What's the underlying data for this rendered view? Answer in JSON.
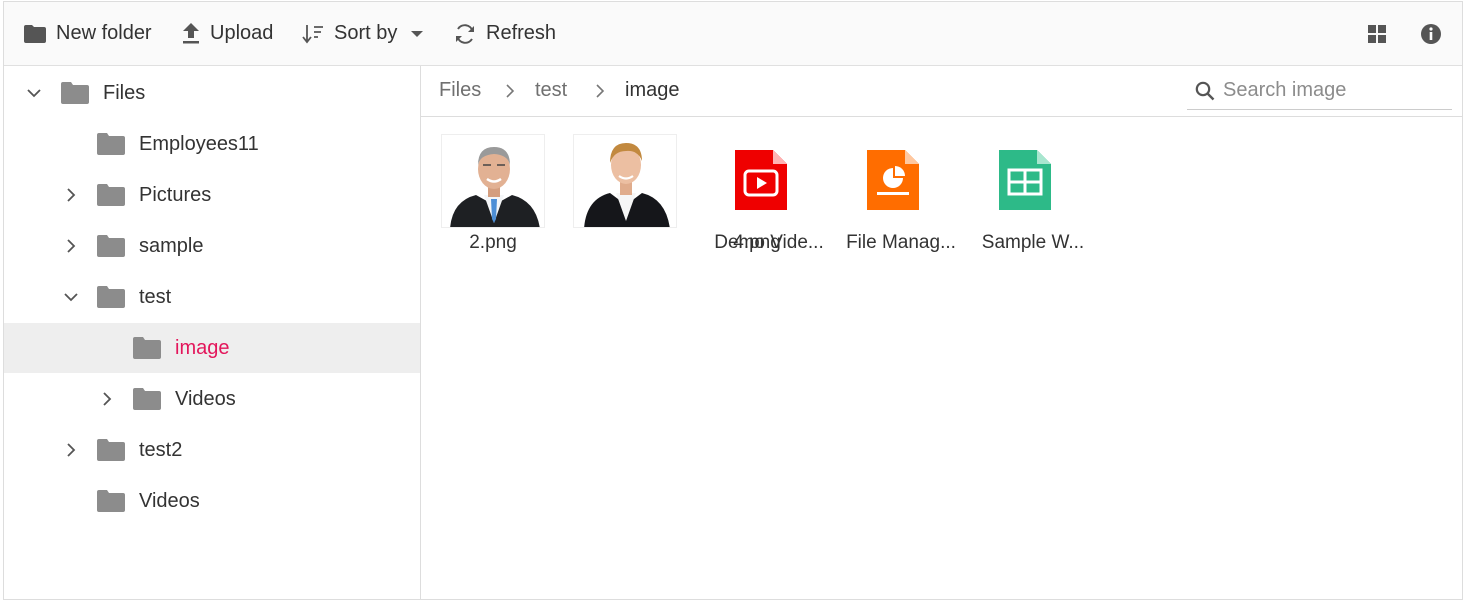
{
  "toolbar": {
    "new_folder": "New folder",
    "upload": "Upload",
    "sort_by": "Sort by",
    "refresh": "Refresh",
    "icons": [
      "folder-icon",
      "upload-icon",
      "sort-icon",
      "caret-down-icon",
      "refresh-icon",
      "grid-view-icon",
      "info-icon"
    ]
  },
  "tree": {
    "root": "Files",
    "items": [
      {
        "label": "Employees11"
      },
      {
        "label": "Pictures"
      },
      {
        "label": "sample"
      },
      {
        "label": "test"
      },
      {
        "label": "image"
      },
      {
        "label": "Videos"
      },
      {
        "label": "test2"
      },
      {
        "label": "Videos"
      }
    ],
    "selected": "image"
  },
  "breadcrumb": {
    "items": [
      "Files",
      "test",
      "image"
    ]
  },
  "search": {
    "placeholder": "Search image"
  },
  "files": [
    {
      "name": "2.png",
      "type": "image"
    },
    {
      "name": "4.png",
      "type": "image"
    },
    {
      "name": "Demo Vide...",
      "type": "video"
    },
    {
      "name": "File Manag...",
      "type": "presentation"
    },
    {
      "name": "Sample W...",
      "type": "spreadsheet"
    }
  ],
  "colors": {
    "accent": "#e3165b",
    "folder": "#8c8c8c",
    "video": "#ef0000",
    "presentation": "#ff6d00",
    "spreadsheet": "#2dba88"
  }
}
